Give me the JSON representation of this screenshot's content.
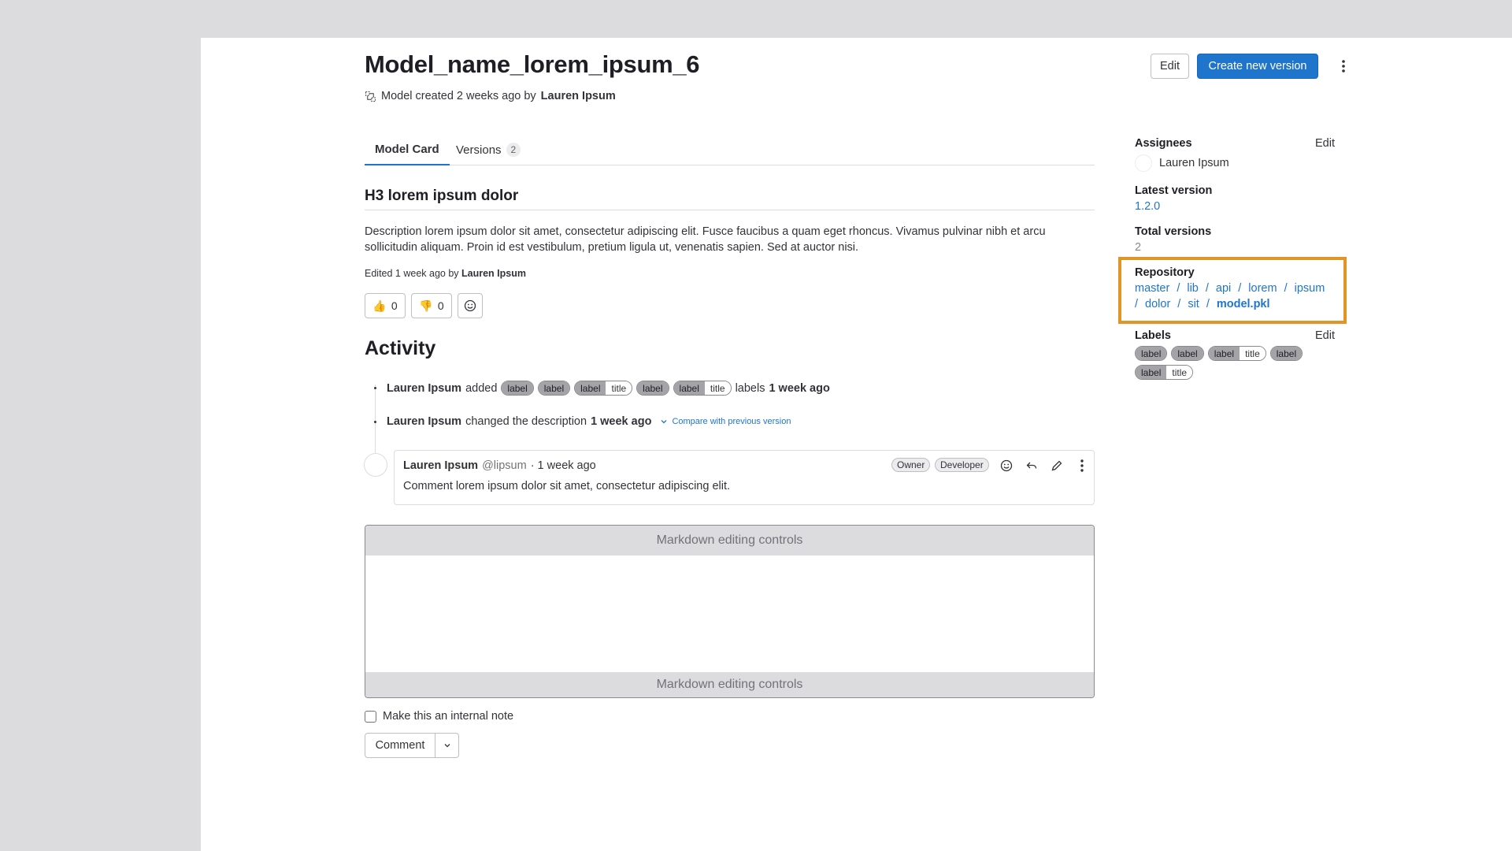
{
  "header": {
    "title": "Model_name_lorem_ipsum_6",
    "meta_prefix": "Model created 2 weeks ago by",
    "meta_author": "Lauren Ipsum",
    "edit_label": "Edit",
    "create_label": "Create new version"
  },
  "tabs": [
    {
      "label": "Model Card",
      "active": true
    },
    {
      "label": "Versions",
      "count": "2"
    }
  ],
  "card": {
    "heading": "H3 lorem ipsum dolor",
    "description": "Description lorem ipsum dolor sit amet, consectetur adipiscing elit. Fusce faucibus a quam eget rhoncus. Vivamus pulvinar nibh et arcu sollicitudin aliquam. Proin id est vestibulum, pretium ligula ut, venenatis sapien. Sed at auctor nisi.",
    "edited_prefix": "Edited 1 week ago by",
    "edited_author": "Lauren Ipsum",
    "thumbs_up": "0",
    "thumbs_down": "0"
  },
  "activity": {
    "heading": "Activity",
    "event1": {
      "author": "Lauren Ipsum",
      "verb": "added",
      "labels": [
        {
          "key": "label"
        },
        {
          "key": "label"
        },
        {
          "key": "label",
          "value": "title"
        },
        {
          "key": "label"
        },
        {
          "key": "label",
          "value": "title"
        }
      ],
      "suffix": "labels",
      "time": "1 week ago"
    },
    "event2": {
      "author": "Lauren Ipsum",
      "verb": "changed the description",
      "time": "1 week ago",
      "compare": "Compare with previous version"
    },
    "comment": {
      "author": "Lauren Ipsum",
      "handle": "@lipsum",
      "time": "· 1 week ago",
      "badge1": "Owner",
      "badge2": "Developer",
      "body": "Comment lorem ipsum dolor sit amet, consectetur adipiscing elit."
    }
  },
  "editor": {
    "controls_top": "Markdown editing controls",
    "controls_bottom": "Markdown editing controls",
    "internal_note": "Make this an internal note",
    "comment_label": "Comment"
  },
  "sidebar": {
    "assignees": {
      "heading": "Assignees",
      "edit": "Edit",
      "name": "Lauren Ipsum"
    },
    "latest_version": {
      "heading": "Latest version",
      "value": "1.2.0"
    },
    "total_versions": {
      "heading": "Total versions",
      "value": "2"
    },
    "repository": {
      "heading": "Repository",
      "path": [
        "master",
        "lib",
        "api",
        "lorem",
        "ipsum",
        "dolor",
        "sit"
      ],
      "file": "model.pkl",
      "highlight_color": "#e29527"
    },
    "labels": {
      "heading": "Labels",
      "edit": "Edit",
      "items": [
        {
          "key": "label"
        },
        {
          "key": "label"
        },
        {
          "key": "label",
          "value": "title"
        },
        {
          "key": "label"
        },
        {
          "key": "label",
          "value": "title"
        }
      ]
    }
  },
  "colors": {
    "accent": "#1f75cb",
    "highlight": "#e29527",
    "background": "#dcdcde"
  }
}
